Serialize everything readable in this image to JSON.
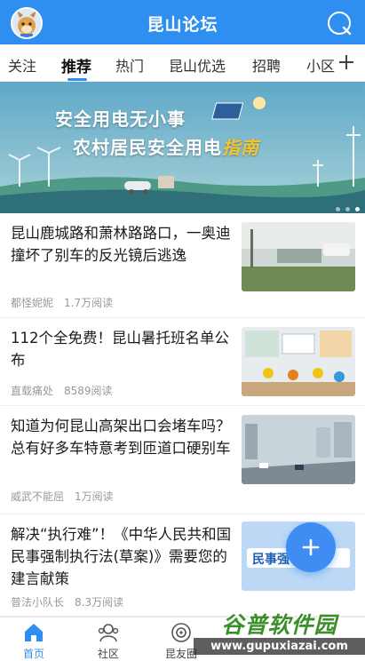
{
  "header": {
    "title": "昆山论坛"
  },
  "tabs": [
    {
      "label": "关注"
    },
    {
      "label": "推荐"
    },
    {
      "label": "热门"
    },
    {
      "label": "昆山优选"
    },
    {
      "label": "招聘"
    },
    {
      "label": "小区"
    }
  ],
  "active_tab": "推荐",
  "banner": {
    "line1": "安全用电无小事",
    "line2_main": "农村居民安全用电",
    "line2_accent": "指南",
    "slide_count": 3,
    "current_slide": 3
  },
  "articles": [
    {
      "title": "昆山鹿城路和萧林路路口，一奥迪撞坏了别车的反光镜后逃逸",
      "author": "都怪妮妮",
      "views": "1.7万阅读"
    },
    {
      "title": "112个全免费！昆山暑托班名单公布",
      "author": "直载痛处",
      "views": "8589阅读"
    },
    {
      "title": "知道为何昆山高架出口会堵车吗？总有好多车特意考到匝道口硬别车",
      "author": "威武不能屈",
      "views": "1万阅读"
    },
    {
      "title": "解决“执行难”！《中华人民共和国民事强制执行法(草案)》需要您的建言献策",
      "author": "普法小队长",
      "views": "8.3万阅读",
      "thumb_text": "民事强"
    }
  ],
  "fab": {
    "symbol": "+"
  },
  "bottom_nav": [
    {
      "label": "首页",
      "icon": "home-icon"
    },
    {
      "label": "社区",
      "icon": "community-icon"
    },
    {
      "label": "昆友圈",
      "icon": "friends-circle-icon"
    }
  ],
  "watermark": {
    "title": "谷普软件园",
    "url": "www.gupuxiazai.com"
  },
  "colors": {
    "primary": "#2f8ff0",
    "text": "#1a1a1a",
    "meta": "#999999"
  }
}
